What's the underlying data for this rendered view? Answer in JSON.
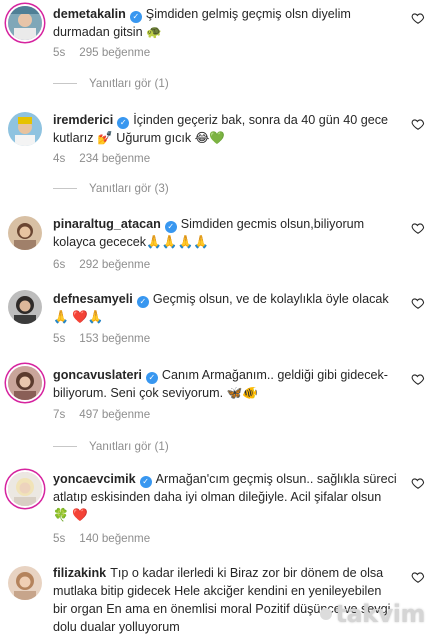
{
  "comments": [
    {
      "username": "demetakalin",
      "text": "Şimdiden gelmiş geçmiş olsn diyelim durmadan gitsin 🐢",
      "time": "5s",
      "likes": "295 beğenme",
      "replies": "Yanıtları gör (1)"
    },
    {
      "username": "iremderici",
      "text": "İçinden geçeriz bak, sonra da 40 gün 40 gece kutlarız 💅 Uğurum gıcık 😂💚",
      "time": "4s",
      "likes": "234 beğenme",
      "replies": "Yanıtları gör (3)"
    },
    {
      "username": "pinaraltug_atacan",
      "text": "Simdiden gecmis olsun,biliyorum kolayca gececek🙏🙏🙏🙏",
      "time": "6s",
      "likes": "292 beğenme"
    },
    {
      "username": "defnesamyeli",
      "text": "Geçmiş olsun, ve de kolaylıkla öyle olacak🙏 ❤️🙏",
      "time": "5s",
      "likes": "153 beğenme"
    },
    {
      "username": "goncavuslateri",
      "text": "Canım Armağanım.. geldiği gibi gidecek- biliyorum. Seni çok seviyorum. 🦋🐠",
      "time": "7s",
      "likes": "497 beğenme",
      "replies": "Yanıtları gör (1)"
    },
    {
      "username": "yoncaevcimik",
      "text": "Armağan'cım geçmiş olsun.. sağlıkla süreci atlatıp eskisinden daha iyi olman dileğiyle. Acil şifalar olsun 🍀 ❤️",
      "time": "5s",
      "likes": "140 beğenme"
    },
    {
      "username": "filizakink",
      "text": "Tıp o kadar ilerledi ki Biraz zor bir dönem de olsa mutlaka bitip gidecek Hele akciğer kendini en yenileyebilen bir organ En ama en önemlisi moral Pozitif düşünce ve sevgi dolu dualar yolluyorum"
    }
  ],
  "watermark": "takvim",
  "colors": {
    "meta": "#8e8e8e",
    "badge": "#3897f0",
    "text": "#262626"
  }
}
